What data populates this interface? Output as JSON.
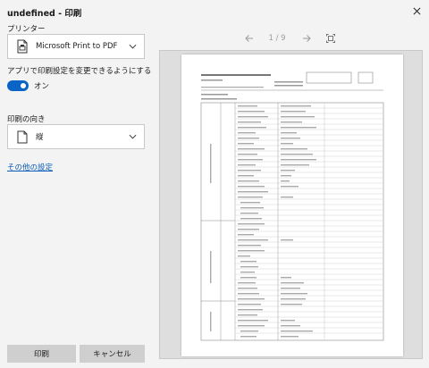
{
  "window": {
    "title": "undefined - 印刷"
  },
  "settings": {
    "printer_label": "プリンター",
    "printer_value": "Microsoft Print to PDF",
    "app_settings_label": "アプリで印刷設定を変更できるようにする",
    "toggle_state": "オン",
    "orientation_label": "印刷の向き",
    "orientation_value": "縦",
    "more_settings_link": "その他の設定",
    "print_button": "印刷",
    "cancel_button": "キャンセル"
  },
  "preview": {
    "page_current": "1",
    "page_separator": "/",
    "page_total": "9",
    "page_indicator": "1 / 9"
  },
  "icons": {
    "close": "close-icon",
    "printer": "printer-icon",
    "page": "page-portrait-icon",
    "chevron": "chevron-down-icon",
    "prev": "arrow-left-icon",
    "next": "arrow-right-icon",
    "fit": "fit-page-icon"
  },
  "colors": {
    "accent": "#0a64c8",
    "link": "#0a5cb8",
    "background": "#f3f3f3",
    "button": "#cfcfcf"
  }
}
